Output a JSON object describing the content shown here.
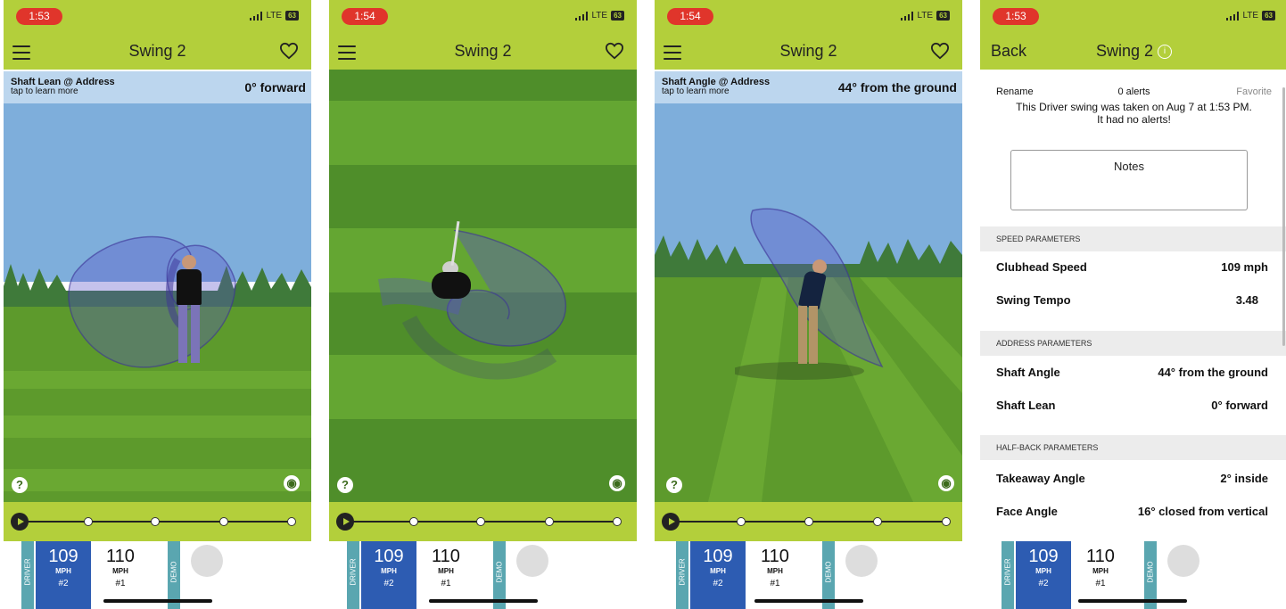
{
  "screens": [
    {
      "time": "1:53",
      "network": "LTE",
      "battery": "63",
      "title": "Swing 2",
      "info_line1": "Shaft Lean @ Address",
      "info_line2": "tap to learn more",
      "info_value": "0° forward",
      "help_icon": "?",
      "camera_icon": "camera-icon"
    },
    {
      "time": "1:54",
      "network": "LTE",
      "battery": "63",
      "title": "Swing 2",
      "help_icon": "?",
      "camera_icon": "camera-icon"
    },
    {
      "time": "1:54",
      "network": "LTE",
      "battery": "63",
      "title": "Swing 2",
      "info_line1": "Shaft Angle @ Address",
      "info_line2": "tap to learn more",
      "info_value": "44° from the ground",
      "help_icon": "?",
      "camera_icon": "camera-icon"
    },
    {
      "time": "1:53",
      "network": "LTE",
      "battery": "63",
      "back": "Back",
      "title": "Swing 2",
      "rename": "Rename",
      "alerts": "0 alerts",
      "favorite": "Favorite",
      "description": "This Driver swing was taken on Aug 7 at 1:53 PM. It had no alerts!",
      "notes": "Notes",
      "sections": [
        {
          "heading": "SPEED PARAMETERS",
          "rows": [
            {
              "label": "Clubhead Speed",
              "value": "109 mph"
            },
            {
              "label": "Swing Tempo",
              "value": "3.48"
            }
          ]
        },
        {
          "heading": "ADDRESS PARAMETERS",
          "rows": [
            {
              "label": "Shaft Angle",
              "value": "44° from the ground"
            },
            {
              "label": "Shaft Lean",
              "value": "0° forward"
            }
          ]
        },
        {
          "heading": "HALF-BACK PARAMETERS",
          "rows": [
            {
              "label": "Takeaway Angle",
              "value": "2° inside"
            },
            {
              "label": "Face Angle",
              "value": "16° closed from vertical"
            }
          ]
        }
      ]
    }
  ],
  "swing_cards": {
    "driver_tag": "DRIVER",
    "demo_tag": "DEMO",
    "card1_speed": "109",
    "card1_unit": "MPH",
    "card1_rank": "#2",
    "card2_speed": "110",
    "card2_unit": "MPH",
    "card2_rank": "#1"
  },
  "colors": {
    "header_green": "#b3cf3b",
    "info_blue": "#bcd6ee",
    "sky": "#7eaedb",
    "grass": "#5d9a2c",
    "card_blue": "#2d5cb2",
    "tag_teal": "#5aa6b0"
  }
}
